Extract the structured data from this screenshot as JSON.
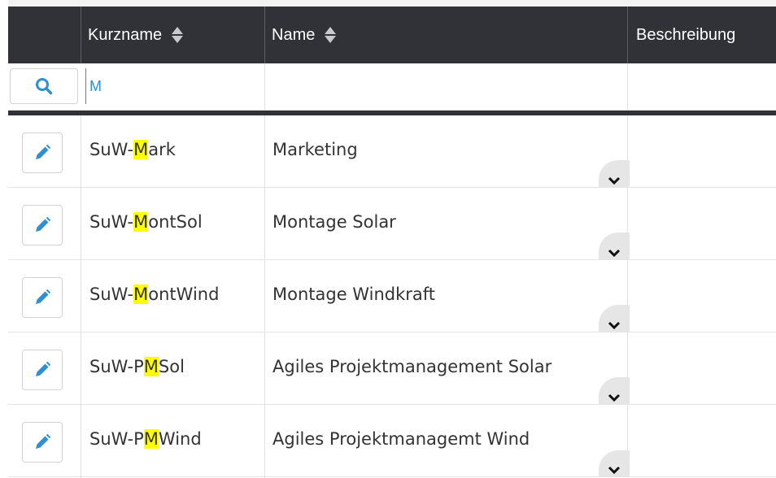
{
  "header": {
    "columns": [
      {
        "label": "Kurzname",
        "sortable": true
      },
      {
        "label": "Name",
        "sortable": true
      },
      {
        "label": "Beschreibung",
        "sortable": false
      }
    ]
  },
  "filter": {
    "search_icon": "magnifier-icon",
    "kurzname_value": "M"
  },
  "rows": [
    {
      "kurzname_pre": "SuW-",
      "kurzname_match": "M",
      "kurzname_post": "ark",
      "name": "Marketing",
      "beschreibung": ""
    },
    {
      "kurzname_pre": "SuW-",
      "kurzname_match": "M",
      "kurzname_post": "ontSol",
      "name": "Montage Solar",
      "beschreibung": ""
    },
    {
      "kurzname_pre": "SuW-",
      "kurzname_match": "M",
      "kurzname_post": "ontWind",
      "name": "Montage Windkraft",
      "beschreibung": ""
    },
    {
      "kurzname_pre": "SuW-P",
      "kurzname_match": "M",
      "kurzname_post": "Sol",
      "name": "Agiles Projektmanagement Solar",
      "beschreibung": ""
    },
    {
      "kurzname_pre": "SuW-P",
      "kurzname_match": "M",
      "kurzname_post": "Wind",
      "name": "Agiles Projektmanagemt Wind",
      "beschreibung": ""
    }
  ],
  "colors": {
    "header_bg": "#303238",
    "accent": "#2f8fd0",
    "highlight": "#ffff00"
  }
}
